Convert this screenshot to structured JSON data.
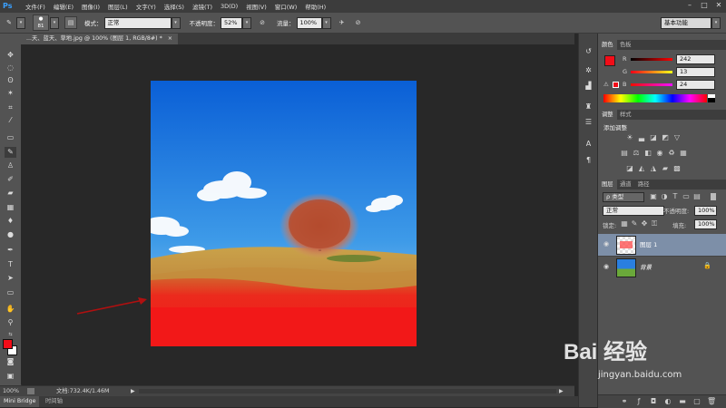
{
  "app": {
    "logo": "Ps"
  },
  "menu": [
    "文件(F)",
    "编辑(E)",
    "图像(I)",
    "图层(L)",
    "文字(Y)",
    "选择(S)",
    "滤镜(T)",
    "3D(D)",
    "视图(V)",
    "窗口(W)",
    "帮助(H)"
  ],
  "window_controls": [
    "–",
    "□",
    "✕"
  ],
  "options": {
    "brush_size": "81",
    "mode_label": "模式：",
    "mode_value": "正常",
    "opacity_label": "不透明度：",
    "opacity_value": "52%",
    "flow_label": "流量：",
    "flow_value": "100%",
    "workspace": "基本功能"
  },
  "document": {
    "tab_title": "...天、蓝天、草地.jpg @ 100% (图层 1, RGB/8#) *",
    "tab_close": "×"
  },
  "status": {
    "zoom": "100%",
    "doc_info": "文档:732.4K/1.46M"
  },
  "bottom_tabs": [
    "Mini Bridge",
    "时间轴"
  ],
  "color_panel": {
    "tabs": [
      "颜色",
      "色板"
    ],
    "r_label": "R",
    "r_value": "242",
    "g_label": "G",
    "g_value": "13",
    "b_label": "B",
    "b_value": "24"
  },
  "adjust_panel": {
    "tabs": [
      "调整",
      "样式"
    ],
    "title": "添加调整"
  },
  "layers_panel": {
    "tabs": [
      "图层",
      "通道",
      "路径"
    ],
    "kind_label": "ρ 类型",
    "blend_mode": "正常",
    "opacity_label": "不透明度:",
    "opacity_value": "100%",
    "lock_label": "锁定:",
    "fill_label": "填充:",
    "fill_value": "100%",
    "layers": [
      {
        "name": "图层 1",
        "selected": true
      },
      {
        "name": "背景",
        "selected": false
      }
    ]
  },
  "watermark": {
    "text": "Bai 经验",
    "url": "jingyan.baidu.com"
  },
  "colors": {
    "foreground": "#f20d18",
    "background": "#ffffff",
    "arrow": "#b01010"
  }
}
